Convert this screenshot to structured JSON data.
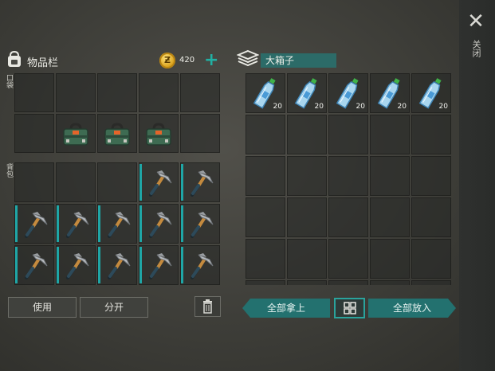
{
  "header": {
    "inventory_title": "物品栏",
    "coins": "420",
    "coin_symbol": "Ƶ",
    "add_coins_symbol": "+",
    "chest_title": "大箱子"
  },
  "close": {
    "symbol": "✕",
    "label": "关闭"
  },
  "sections": {
    "pockets": "口袋",
    "backpack": "背包"
  },
  "pockets": [
    {
      "item": "",
      "bar": false
    },
    {
      "item": "",
      "bar": false
    },
    {
      "item": "",
      "bar": false
    },
    {
      "item": "",
      "bar": false
    },
    {
      "item": "",
      "bar": false
    },
    {
      "item": "",
      "bar": false
    },
    {
      "item": "toolbox",
      "bar": false
    },
    {
      "item": "toolbox",
      "bar": false
    },
    {
      "item": "toolbox",
      "bar": false
    },
    {
      "item": "",
      "bar": false
    }
  ],
  "backpack": [
    {
      "item": "",
      "bar": false
    },
    {
      "item": "",
      "bar": false
    },
    {
      "item": "",
      "bar": false
    },
    {
      "item": "hammer",
      "bar": true
    },
    {
      "item": "hammer",
      "bar": true
    },
    {
      "item": "hammer",
      "bar": true
    },
    {
      "item": "hammer",
      "bar": true
    },
    {
      "item": "hammer",
      "bar": true
    },
    {
      "item": "hammer",
      "bar": true
    },
    {
      "item": "hammer",
      "bar": true
    },
    {
      "item": "hammer",
      "bar": true
    },
    {
      "item": "hammer",
      "bar": true
    },
    {
      "item": "hammer",
      "bar": true
    },
    {
      "item": "hammer",
      "bar": true
    },
    {
      "item": "hammer",
      "bar": true
    }
  ],
  "chest": [
    {
      "item": "water-bottle",
      "qty": "20"
    },
    {
      "item": "water-bottle",
      "qty": "20"
    },
    {
      "item": "water-bottle",
      "qty": "20"
    },
    {
      "item": "water-bottle",
      "qty": "20"
    },
    {
      "item": "water-bottle",
      "qty": "20"
    },
    {
      "item": "",
      "qty": ""
    },
    {
      "item": "",
      "qty": ""
    },
    {
      "item": "",
      "qty": ""
    },
    {
      "item": "",
      "qty": ""
    },
    {
      "item": "",
      "qty": ""
    },
    {
      "item": "",
      "qty": ""
    },
    {
      "item": "",
      "qty": ""
    },
    {
      "item": "",
      "qty": ""
    },
    {
      "item": "",
      "qty": ""
    },
    {
      "item": "",
      "qty": ""
    },
    {
      "item": "",
      "qty": ""
    },
    {
      "item": "",
      "qty": ""
    },
    {
      "item": "",
      "qty": ""
    },
    {
      "item": "",
      "qty": ""
    },
    {
      "item": "",
      "qty": ""
    },
    {
      "item": "",
      "qty": ""
    },
    {
      "item": "",
      "qty": ""
    },
    {
      "item": "",
      "qty": ""
    },
    {
      "item": "",
      "qty": ""
    },
    {
      "item": "",
      "qty": ""
    },
    {
      "item": "",
      "qty": ""
    },
    {
      "item": "",
      "qty": ""
    },
    {
      "item": "",
      "qty": ""
    },
    {
      "item": "",
      "qty": ""
    },
    {
      "item": "",
      "qty": ""
    }
  ],
  "buttons": {
    "use": "使用",
    "split": "分开",
    "take_all": "全部拿上",
    "put_all": "全部放入"
  },
  "colors": {
    "accent": "#1fa6a6",
    "teal_button": "#23716f",
    "coin": "#d9a019"
  }
}
